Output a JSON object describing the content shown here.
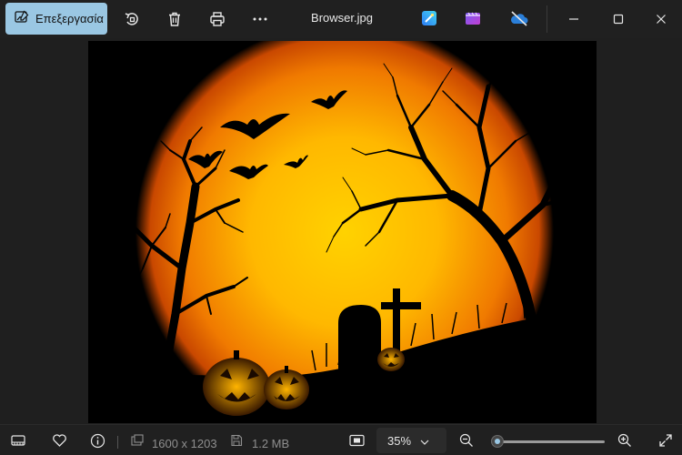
{
  "toolbar": {
    "edit_label": "Επεξεργασία",
    "title": "Browser.jpg"
  },
  "icons": {
    "edit": "edit-photo-icon",
    "rotate": "rotate-icon",
    "delete": "trash-icon",
    "print": "printer-icon",
    "more": "more-icon",
    "designer": "designer-app-icon",
    "clipchamp": "clipchamp-app-icon",
    "onedrive": "onedrive-off-icon"
  },
  "statusbar": {
    "dimensions": "1600 x 1203",
    "file_size": "1.2 MB",
    "zoom": "35%",
    "zoom_fraction": 0.05
  },
  "colors": {
    "accent": "#9ac7e3",
    "background": "#202020",
    "moon_core": "#ffc400",
    "moon_edge": "#e85a00"
  }
}
